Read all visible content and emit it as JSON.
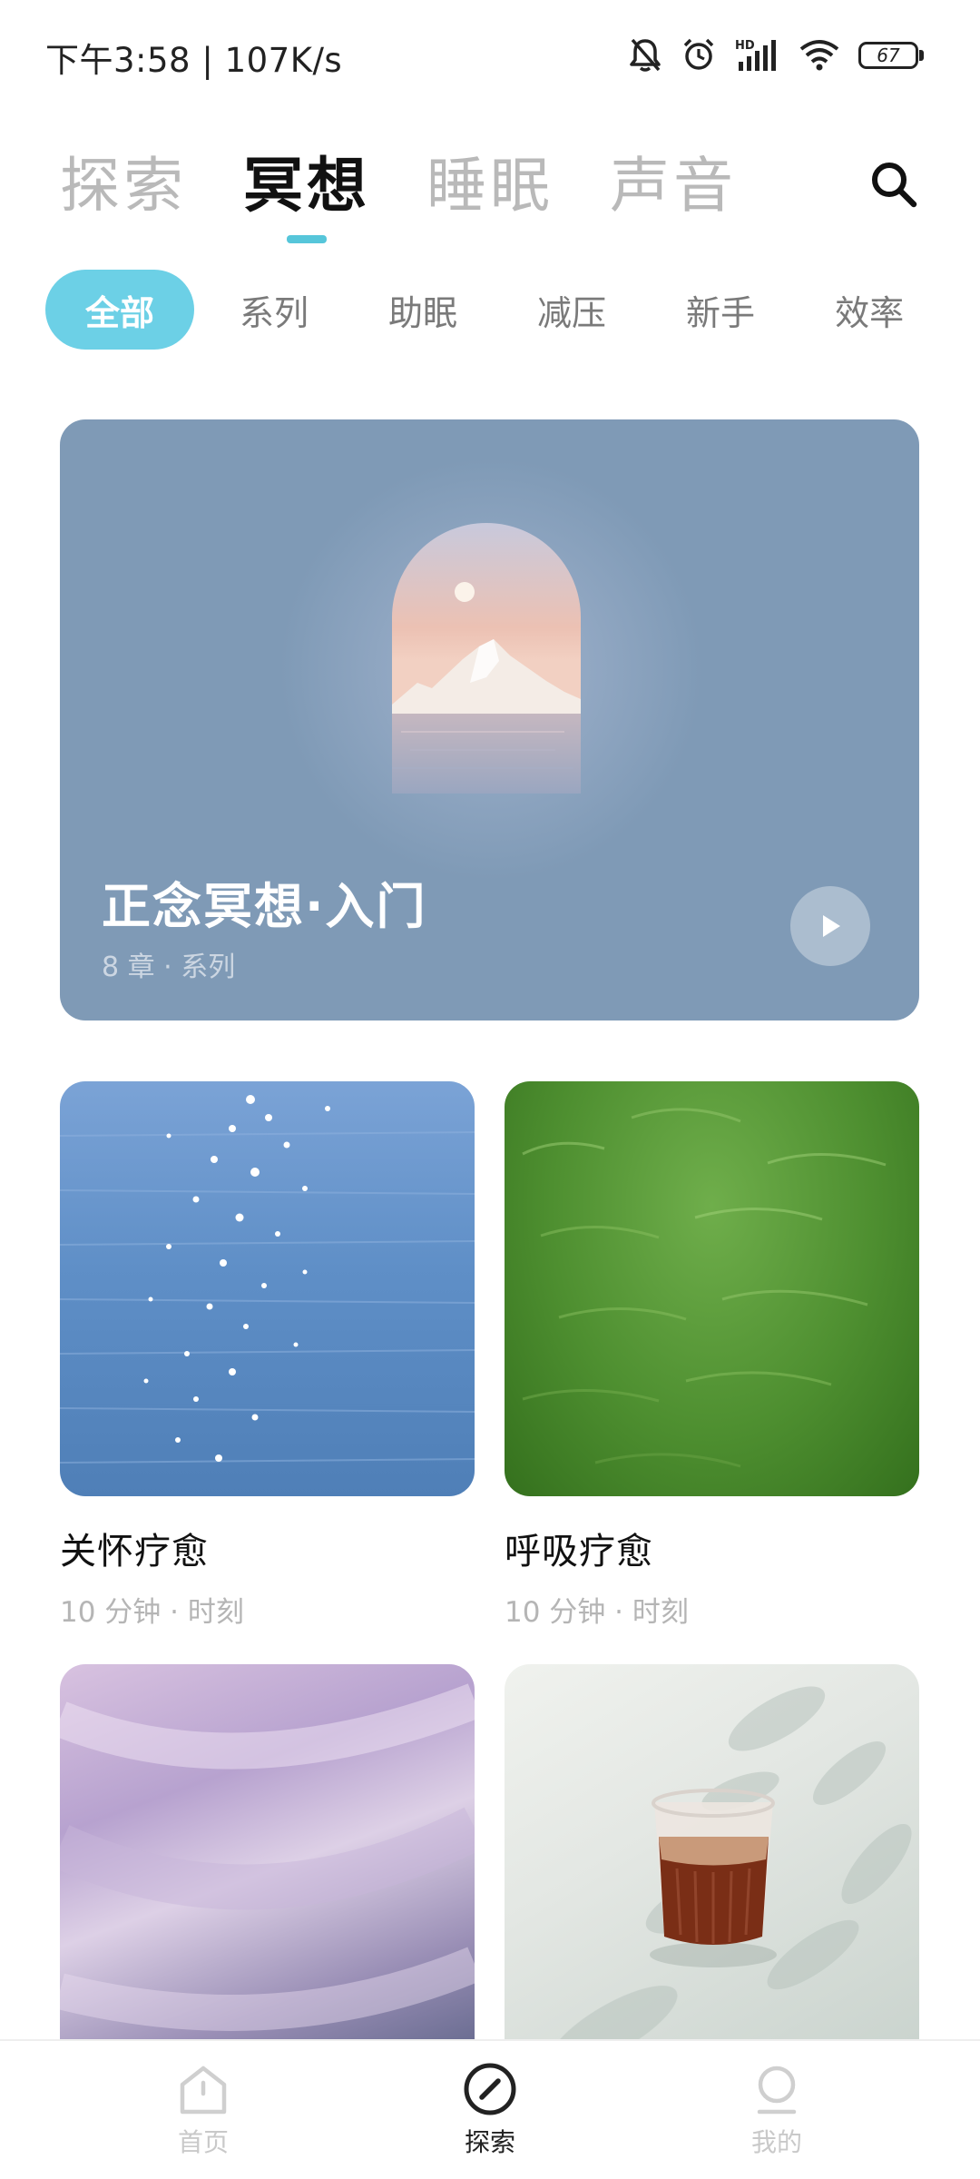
{
  "status_bar": {
    "time": "下午3:58 | 107K/s",
    "battery": "67",
    "icons": [
      "bell-muted-icon",
      "alarm-icon",
      "hd-signal-icon",
      "wifi-icon",
      "battery-icon"
    ]
  },
  "top_tabs": [
    {
      "label": "探索",
      "active": false
    },
    {
      "label": "冥想",
      "active": true
    },
    {
      "label": "睡眠",
      "active": false
    },
    {
      "label": "声音",
      "active": false
    }
  ],
  "chips": [
    {
      "label": "全部",
      "active": true
    },
    {
      "label": "系列",
      "active": false
    },
    {
      "label": "助眠",
      "active": false
    },
    {
      "label": "减压",
      "active": false
    },
    {
      "label": "新手",
      "active": false
    },
    {
      "label": "效率",
      "active": false
    }
  ],
  "featured": {
    "title": "正念冥想·入门",
    "meta": "8 章 · 系列"
  },
  "cards": [
    {
      "title": "关怀疗愈",
      "meta": "10 分钟 · 时刻"
    },
    {
      "title": "呼吸疗愈",
      "meta": "10 分钟 · 时刻"
    },
    {
      "title": "",
      "meta": ""
    },
    {
      "title": "",
      "meta": ""
    }
  ],
  "bottom_nav": [
    {
      "label": "首页",
      "icon": "home-icon",
      "active": false
    },
    {
      "label": "探索",
      "icon": "compass-icon",
      "active": true
    },
    {
      "label": "我的",
      "icon": "profile-icon",
      "active": false
    }
  ],
  "colors": {
    "accent": "#56c6da",
    "chip_active": "#6cd0e6",
    "featured_bg": "#7f9ab6"
  }
}
